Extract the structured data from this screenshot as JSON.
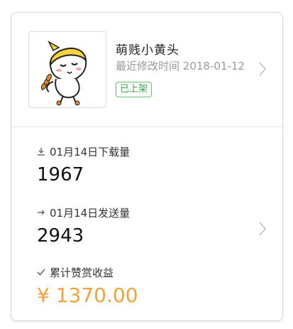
{
  "item": {
    "title": "萌贱小黄头",
    "modified_label": "最近修改时间",
    "modified_date": "2018-01-12",
    "status_badge": "已上架"
  },
  "stats": {
    "downloads_label": "01月14日下载量",
    "downloads_value": "1967",
    "sends_label": "01月14日发送量",
    "sends_value": "2943",
    "reward_label": "累计赞赏收益",
    "reward_value": "¥ 1370.00"
  },
  "icons": {
    "downloads": "download-icon",
    "sends": "arrow-right-icon",
    "reward": "check-icon",
    "chevron": "chevron-right-icon"
  },
  "colors": {
    "badge": "#3fa74f",
    "reward_value": "#f2a23a",
    "border": "#d9d9d9"
  }
}
